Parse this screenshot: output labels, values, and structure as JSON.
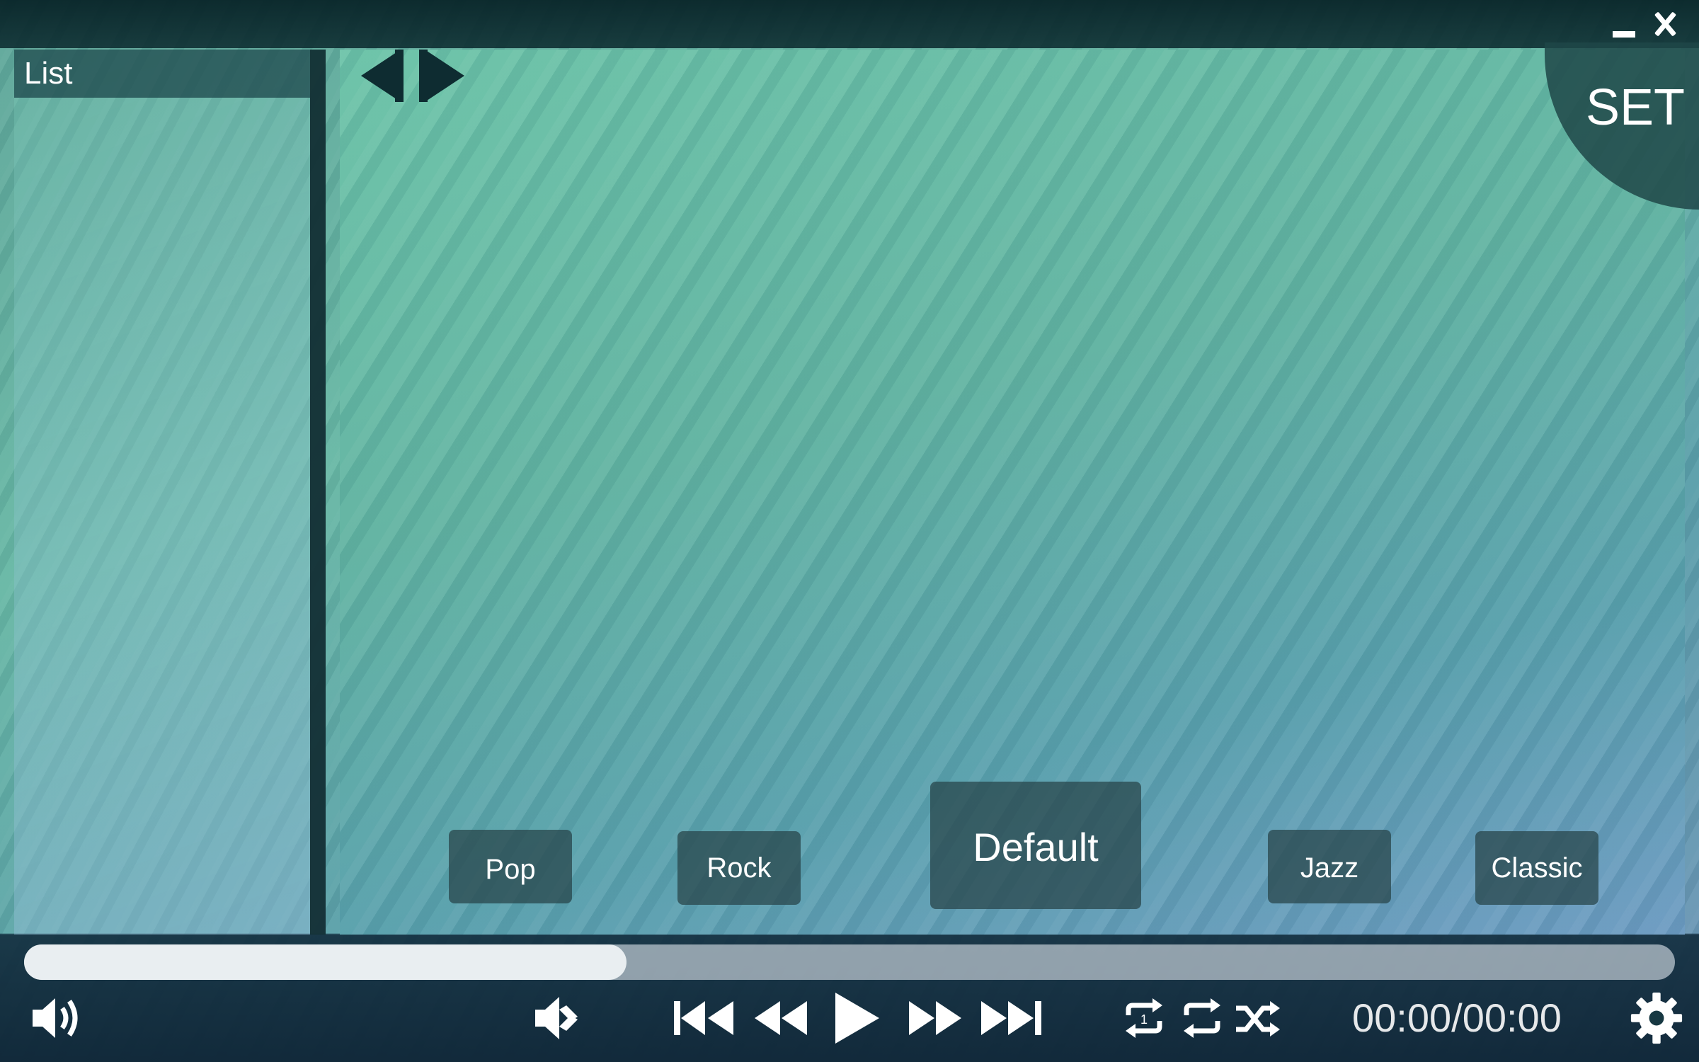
{
  "window": {
    "minimize_icon": "minimize-icon",
    "close_icon": "close-icon"
  },
  "list_panel": {
    "title": "List"
  },
  "main": {
    "set_label": "SET",
    "nav_prev_icon": "triangle-left-icon",
    "nav_next_icon": "triangle-right-icon"
  },
  "genres": {
    "pop": "Pop",
    "rock": "Rock",
    "default": "Default",
    "jazz": "Jazz",
    "classic": "Classic"
  },
  "playback": {
    "progress_fraction": 0.365,
    "time": "00:00/00:00"
  },
  "controls": {
    "volume_icon": "speaker-icon",
    "mute_icon": "mute-icon",
    "skip_prev_icon": "skip-previous-icon",
    "rewind_icon": "rewind-icon",
    "play_icon": "play-icon",
    "fast_forward_icon": "fast-forward-icon",
    "skip_next_icon": "skip-next-icon",
    "repeat_one_icon": "repeat-one-icon",
    "repeat_icon": "repeat-icon",
    "shuffle_icon": "shuffle-icon",
    "settings_icon": "gear-icon"
  },
  "colors": {
    "panel_dark": "#0e2c31",
    "button_bg": "#28464b",
    "progress_fill": "#e9eef1",
    "text": "#ffffff"
  }
}
